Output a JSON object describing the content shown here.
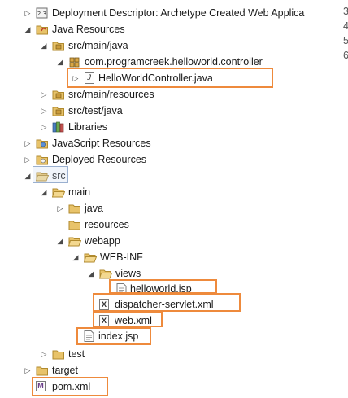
{
  "line_numbers": [
    "3",
    "4",
    "5",
    "6"
  ],
  "tree": {
    "deployment_descriptor": "Deployment Descriptor: Archetype Created Web Applica",
    "java_resources": "Java Resources",
    "src_main_java": "src/main/java",
    "package": "com.programcreek.helloworld.controller",
    "controller_file": "HelloWorldController.java",
    "src_main_resources": "src/main/resources",
    "src_test_java": "src/test/java",
    "libraries": "Libraries",
    "javascript_resources": "JavaScript Resources",
    "deployed_resources": "Deployed Resources",
    "src": "src",
    "main": "main",
    "java": "java",
    "resources": "resources",
    "webapp": "webapp",
    "web_inf": "WEB-INF",
    "views": "views",
    "helloworld_jsp": "helloworld.jsp",
    "dispatcher_xml": "dispatcher-servlet.xml",
    "web_xml": "web.xml",
    "index_jsp": "index.jsp",
    "test": "test",
    "target": "target",
    "pom_xml": "pom.xml"
  },
  "colors": {
    "highlight": "#ee8a3c",
    "folder": "#e8c36a",
    "folder_stroke": "#b08a2e"
  }
}
